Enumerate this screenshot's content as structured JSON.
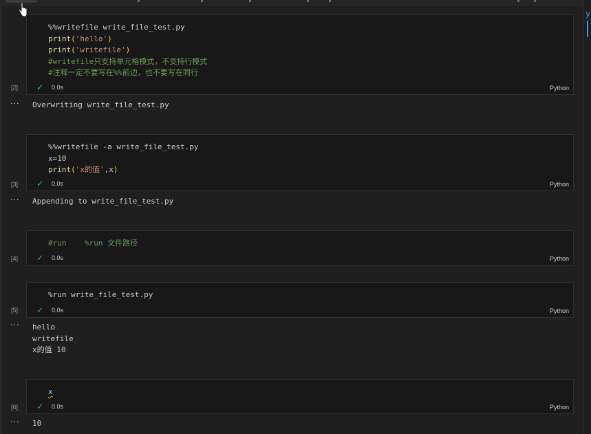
{
  "cells": [
    {
      "count": "[2]",
      "code_lines": [
        [
          {
            "t": "%%writefile write_file_test.py",
            "c": "c-magic"
          }
        ],
        [
          {
            "t": "print",
            "c": "c-fn"
          },
          {
            "t": "(",
            "c": "c-paren"
          },
          {
            "t": "'hello'",
            "c": "c-str"
          },
          {
            "t": ")",
            "c": "c-paren"
          }
        ],
        [
          {
            "t": "print",
            "c": "c-fn"
          },
          {
            "t": "(",
            "c": "c-paren"
          },
          {
            "t": "'writefile'",
            "c": "c-str"
          },
          {
            "t": ")",
            "c": "c-paren"
          }
        ],
        [
          {
            "t": "#writefile只支持单元格模式，不支持行模式",
            "c": "c-comment"
          }
        ],
        [
          {
            "t": "#注释一定不要写在%%前边，也不要写在同行",
            "c": "c-comment"
          }
        ]
      ],
      "status": "0.0s",
      "language": "Python",
      "output": [
        "Overwriting write_file_test.py"
      ]
    },
    {
      "count": "[3]",
      "code_lines": [
        [
          {
            "t": "%%writefile -a write_file_test.py",
            "c": "c-magic"
          }
        ],
        [
          {
            "t": "x",
            "c": "c-var"
          },
          {
            "t": "=",
            "c": "c-plain"
          },
          {
            "t": "10",
            "c": "c-num"
          }
        ],
        [
          {
            "t": "print",
            "c": "c-fn"
          },
          {
            "t": "(",
            "c": "c-paren"
          },
          {
            "t": "'x的值'",
            "c": "c-str"
          },
          {
            "t": ",x",
            "c": "c-plain"
          },
          {
            "t": ")",
            "c": "c-paren"
          }
        ]
      ],
      "status": "0.0s",
      "language": "Python",
      "output": [
        "Appending to write_file_test.py"
      ]
    },
    {
      "count": "[4]",
      "code_lines": [
        [
          {
            "t": "#run    %run 文件路径",
            "c": "c-comment"
          }
        ]
      ],
      "status": "0.0s",
      "language": "Python",
      "output": []
    },
    {
      "count": "[5]",
      "code_lines": [
        [
          {
            "t": "%run write_file_test.py",
            "c": "c-magic"
          }
        ]
      ],
      "status": "0.0s",
      "language": "Python",
      "output": [
        "hello",
        "writefile",
        "x的值 10"
      ]
    },
    {
      "count": "[6]",
      "code_lines": [
        [
          {
            "t": "x",
            "c": "c-var squiggle"
          }
        ]
      ],
      "status": "0.0s",
      "language": "Python",
      "output": [
        "10"
      ]
    }
  ],
  "output_more_glyph": "···",
  "success_icon": "check-icon",
  "colors": {
    "background": "#1f1f1f",
    "cell_background": "#181818",
    "success": "#3fb950",
    "string": "#ce9178",
    "comment": "#6a9955",
    "function": "#dcdcaa",
    "number": "#b5cea8"
  }
}
